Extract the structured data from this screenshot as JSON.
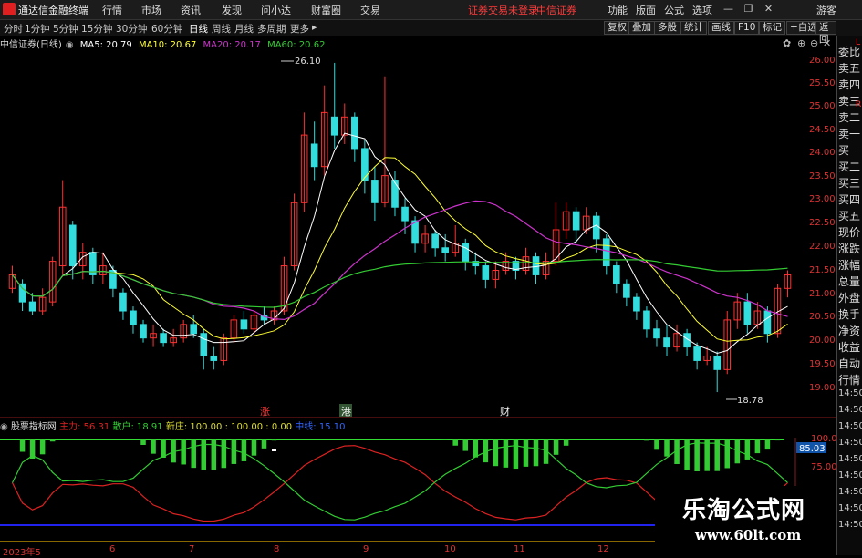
{
  "app": {
    "title": "通达信金融终端"
  },
  "menu": [
    "行情",
    "市场",
    "资讯",
    "发现",
    "问小达",
    "财富圈",
    "交易"
  ],
  "status": {
    "login": "证券交易未登录",
    "broker": "中信证券"
  },
  "menu_right": [
    "功能",
    "版面",
    "公式",
    "选项"
  ],
  "guest": "游客",
  "periods": [
    "分时",
    "1分钟",
    "5分钟",
    "15分钟",
    "30分钟",
    "60分钟",
    "日线",
    "周线",
    "月线",
    "多周期",
    "更多"
  ],
  "tools": [
    "复权",
    "叠加",
    "多股",
    "统计",
    "画线",
    "F10",
    "标记",
    "+自选",
    "返回"
  ],
  "info": {
    "stock": "中信证券(日线)",
    "ma5": "MA5: 20.79",
    "ma10": "MA10: 20.67",
    "ma20": "MA20: 20.17",
    "ma60": "MA60: 20.62"
  },
  "annotations": {
    "high": "26.10",
    "low": "18.78"
  },
  "markers": [
    "涨",
    "港",
    "财"
  ],
  "price_ticks": [
    "26.00",
    "25.50",
    "25.00",
    "24.50",
    "24.00",
    "23.50",
    "23.00",
    "22.50",
    "22.00",
    "21.50",
    "21.00",
    "20.50",
    "20.00",
    "19.50",
    "19.00"
  ],
  "lower": {
    "name": "股票指标网",
    "zhuli": "主力: 56.31",
    "sanhu": "散户: 18.91",
    "xinzhuang": "新庄: 100.00 : 100.00 : 0.00",
    "zhongxian": "中线: 15.10",
    "ticks": [
      "100.0",
      "75.00"
    ],
    "current": "85.03"
  },
  "dates": [
    "2023年5",
    "6",
    "7",
    "8",
    "9",
    "10",
    "11",
    "12"
  ],
  "right_panel": [
    "委比",
    "卖五",
    "卖四",
    "卖三",
    "卖二",
    "卖一",
    "买一",
    "买二",
    "买三",
    "买四",
    "买五",
    "现价",
    "涨跌",
    "涨幅",
    "总量",
    "外盘",
    "换手",
    "净资",
    "收益",
    "自动",
    "行情"
  ],
  "right_letters": {
    "l": "L",
    "r": "R"
  },
  "right_times": [
    "14:50",
    "14:50",
    "14:50",
    "14:50",
    "14:50",
    "14:50",
    "14:50",
    "14:50",
    "14:50"
  ],
  "watermark": {
    "line1": "乐淘公式网",
    "line2": "www.60lt.com"
  },
  "colors": {
    "up": "#ff3333",
    "down": "#33dddd",
    "ma5": "#ffffff",
    "ma10": "#ffff33",
    "ma20": "#cc33cc",
    "ma60": "#33cc33",
    "zhuli": "#dd2222",
    "sanhu": "#33cc33",
    "zhongxian": "#3333ff"
  },
  "chart_data": {
    "type": "candlestick",
    "price_range": [
      18.7,
      26.2
    ],
    "ma": [
      "MA5",
      "MA10",
      "MA20",
      "MA60"
    ],
    "candles": [
      [
        21.1,
        21.4,
        21.0,
        21.6
      ],
      [
        21.2,
        20.8,
        20.6,
        21.3
      ],
      [
        20.8,
        20.6,
        20.5,
        21.0
      ],
      [
        20.6,
        20.9,
        20.5,
        21.1
      ],
      [
        20.8,
        21.7,
        20.7,
        21.8
      ],
      [
        21.6,
        22.9,
        21.4,
        23.5
      ],
      [
        22.5,
        21.6,
        21.3,
        22.6
      ],
      [
        21.6,
        21.9,
        21.3,
        22.1
      ],
      [
        21.9,
        21.4,
        21.2,
        22.0
      ],
      [
        21.4,
        21.6,
        21.2,
        21.9
      ],
      [
        21.5,
        21.1,
        20.9,
        21.6
      ],
      [
        21.0,
        20.6,
        20.4,
        21.1
      ],
      [
        20.6,
        20.3,
        20.1,
        20.7
      ],
      [
        20.3,
        20.0,
        19.9,
        20.4
      ],
      [
        20.0,
        20.1,
        19.8,
        20.3
      ],
      [
        20.1,
        19.9,
        19.8,
        20.2
      ],
      [
        19.9,
        20.0,
        19.8,
        20.2
      ],
      [
        20.0,
        20.3,
        19.9,
        20.4
      ],
      [
        20.3,
        20.1,
        20.0,
        20.5
      ],
      [
        20.1,
        19.6,
        19.3,
        20.2
      ],
      [
        19.6,
        19.5,
        19.3,
        19.8
      ],
      [
        19.5,
        20.0,
        19.4,
        20.1
      ],
      [
        20.0,
        20.4,
        19.9,
        20.5
      ],
      [
        20.4,
        20.2,
        20.1,
        20.6
      ],
      [
        20.2,
        20.5,
        20.1,
        20.6
      ],
      [
        20.5,
        20.4,
        20.3,
        20.7
      ],
      [
        20.4,
        20.6,
        20.3,
        20.7
      ],
      [
        20.6,
        21.6,
        20.5,
        21.8
      ],
      [
        21.6,
        23.0,
        21.5,
        23.2
      ],
      [
        23.0,
        24.5,
        22.8,
        25.0
      ],
      [
        24.3,
        23.8,
        23.5,
        24.8
      ],
      [
        23.8,
        25.0,
        23.6,
        25.6
      ],
      [
        24.9,
        24.5,
        24.2,
        26.1
      ],
      [
        24.5,
        24.9,
        24.3,
        25.2
      ],
      [
        24.9,
        24.2,
        23.9,
        25.0
      ],
      [
        24.2,
        23.5,
        23.2,
        24.4
      ],
      [
        23.5,
        23.0,
        22.6,
        23.8
      ],
      [
        23.0,
        23.6,
        22.9,
        25.8
      ],
      [
        23.5,
        22.9,
        22.7,
        23.7
      ],
      [
        22.9,
        22.6,
        22.3,
        23.1
      ],
      [
        22.6,
        22.1,
        21.9,
        22.7
      ],
      [
        22.1,
        22.3,
        21.9,
        22.5
      ],
      [
        22.3,
        22.0,
        21.8,
        22.4
      ],
      [
        22.0,
        21.9,
        21.7,
        22.3
      ],
      [
        21.9,
        22.1,
        21.8,
        22.5
      ],
      [
        22.1,
        21.7,
        21.5,
        22.2
      ],
      [
        21.7,
        21.6,
        21.4,
        21.9
      ],
      [
        21.6,
        21.3,
        21.1,
        21.7
      ],
      [
        21.3,
        21.5,
        21.1,
        21.7
      ],
      [
        21.5,
        21.7,
        21.4,
        21.9
      ],
      [
        21.7,
        21.5,
        21.3,
        21.8
      ],
      [
        21.5,
        21.8,
        21.4,
        22.0
      ],
      [
        21.8,
        21.4,
        21.2,
        21.9
      ],
      [
        21.4,
        21.7,
        21.3,
        21.9
      ],
      [
        21.7,
        22.4,
        21.6,
        23.0
      ],
      [
        22.4,
        22.8,
        22.2,
        23.0
      ],
      [
        22.8,
        22.4,
        22.1,
        22.9
      ],
      [
        22.4,
        22.7,
        22.3,
        22.9
      ],
      [
        22.7,
        22.2,
        21.9,
        22.8
      ],
      [
        22.2,
        21.6,
        21.4,
        22.3
      ],
      [
        21.6,
        21.2,
        21.0,
        21.7
      ],
      [
        21.2,
        20.9,
        20.7,
        21.3
      ],
      [
        20.9,
        20.6,
        20.4,
        21.0
      ],
      [
        20.6,
        20.2,
        20.0,
        20.7
      ],
      [
        20.2,
        20.0,
        19.8,
        20.4
      ],
      [
        20.0,
        19.8,
        19.6,
        20.3
      ],
      [
        19.8,
        20.1,
        19.7,
        20.3
      ],
      [
        20.1,
        19.8,
        19.6,
        20.2
      ],
      [
        19.8,
        19.5,
        19.3,
        19.9
      ],
      [
        19.5,
        19.6,
        19.4,
        19.8
      ],
      [
        19.6,
        19.3,
        18.8,
        19.7
      ],
      [
        19.3,
        20.4,
        19.2,
        20.6
      ],
      [
        20.4,
        20.8,
        20.2,
        21.0
      ],
      [
        20.8,
        20.3,
        20.1,
        21.0
      ],
      [
        20.3,
        20.6,
        20.2,
        20.8
      ],
      [
        20.6,
        20.1,
        19.9,
        20.7
      ],
      [
        20.1,
        21.1,
        20.0,
        21.2
      ],
      [
        21.1,
        21.4,
        20.9,
        21.5
      ]
    ]
  }
}
